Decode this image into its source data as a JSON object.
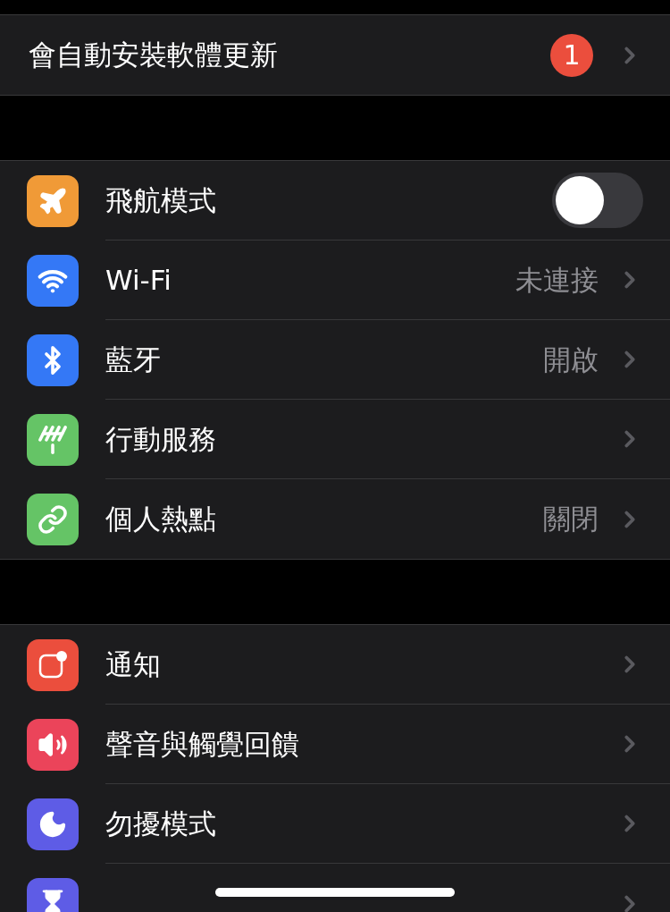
{
  "sections": [
    {
      "rows": [
        {
          "kind": "badge",
          "label": "會自動安裝軟體更新",
          "badge": "1"
        }
      ]
    },
    {
      "rows": [
        {
          "kind": "toggle",
          "label": "飛航模式",
          "on": false,
          "color": "#f09a37"
        },
        {
          "kind": "value",
          "label": "Wi-Fi",
          "value": "未連接",
          "color": "#3478f6"
        },
        {
          "kind": "value",
          "label": "藍牙",
          "value": "開啟",
          "color": "#3478f6"
        },
        {
          "kind": "plain",
          "label": "行動服務",
          "color": "#65c466"
        },
        {
          "kind": "value",
          "label": "個人熱點",
          "value": "關閉",
          "color": "#65c466"
        }
      ]
    },
    {
      "rows": [
        {
          "kind": "plain",
          "label": "通知",
          "color": "#eb4e3d"
        },
        {
          "kind": "plain",
          "label": "聲音與觸覺回饋",
          "color": "#eb445a"
        },
        {
          "kind": "plain",
          "label": "勿擾模式",
          "color": "#5e5ce6"
        },
        {
          "kind": "plain",
          "color": "#5e5ce6"
        }
      ]
    }
  ]
}
